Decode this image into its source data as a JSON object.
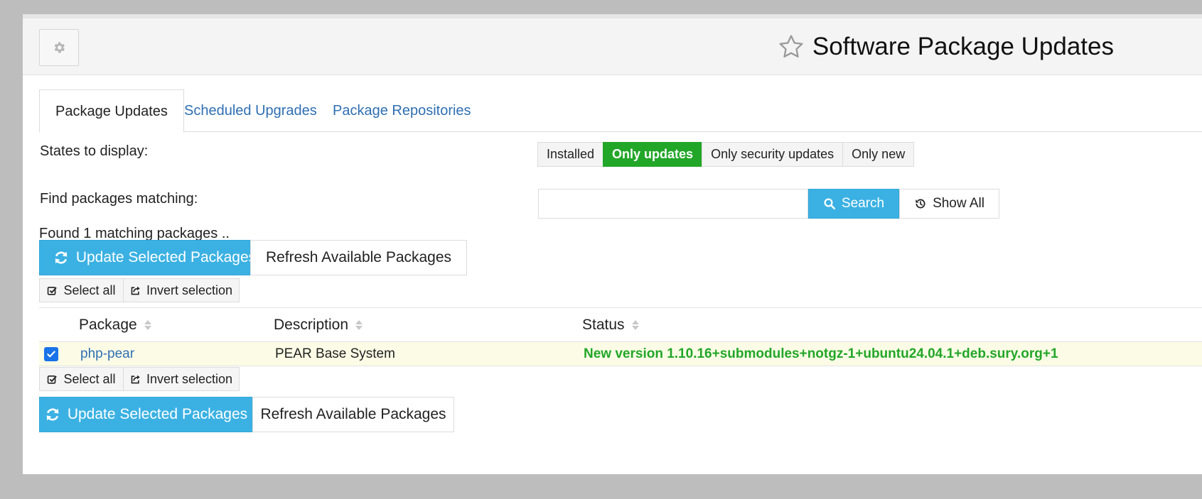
{
  "header": {
    "title": "Software Package Updates"
  },
  "tabs": [
    {
      "label": "Package Updates",
      "active": true
    },
    {
      "label": "Scheduled Upgrades",
      "active": false
    },
    {
      "label": "Package Repositories",
      "active": false
    }
  ],
  "filters": {
    "states_label": "States to display:",
    "states": [
      {
        "label": "Installed",
        "selected": false
      },
      {
        "label": "Only updates",
        "selected": true
      },
      {
        "label": "Only security updates",
        "selected": false
      },
      {
        "label": "Only new",
        "selected": false
      }
    ],
    "find_label": "Find packages matching:",
    "search_value": "",
    "search_button": "Search",
    "show_all_button": "Show All"
  },
  "results": {
    "found_text": "Found 1 matching packages .."
  },
  "actions": {
    "update_selected": "Update Selected Packages",
    "refresh_available": "Refresh Available Packages",
    "select_all": "Select all",
    "invert_selection": "Invert selection"
  },
  "table": {
    "columns": [
      "Package",
      "Description",
      "Status"
    ],
    "rows": [
      {
        "checked": true,
        "package": "php-pear",
        "description": "PEAR Base System",
        "status": "New version 1.10.16+submodules+notgz-1+ubuntu24.04.1+deb.sury.org+1"
      }
    ]
  },
  "colors": {
    "primary": "#3bb1e3",
    "success": "#22a628",
    "link": "#2f6fb3",
    "row_highlight": "#fcfce6"
  },
  "icons": {
    "settings": "gear-icon",
    "favorite": "star-outline-icon",
    "search": "search-icon",
    "show_all": "history-icon",
    "update": "refresh-icon",
    "select_all": "check-square-icon",
    "invert": "share-icon"
  }
}
